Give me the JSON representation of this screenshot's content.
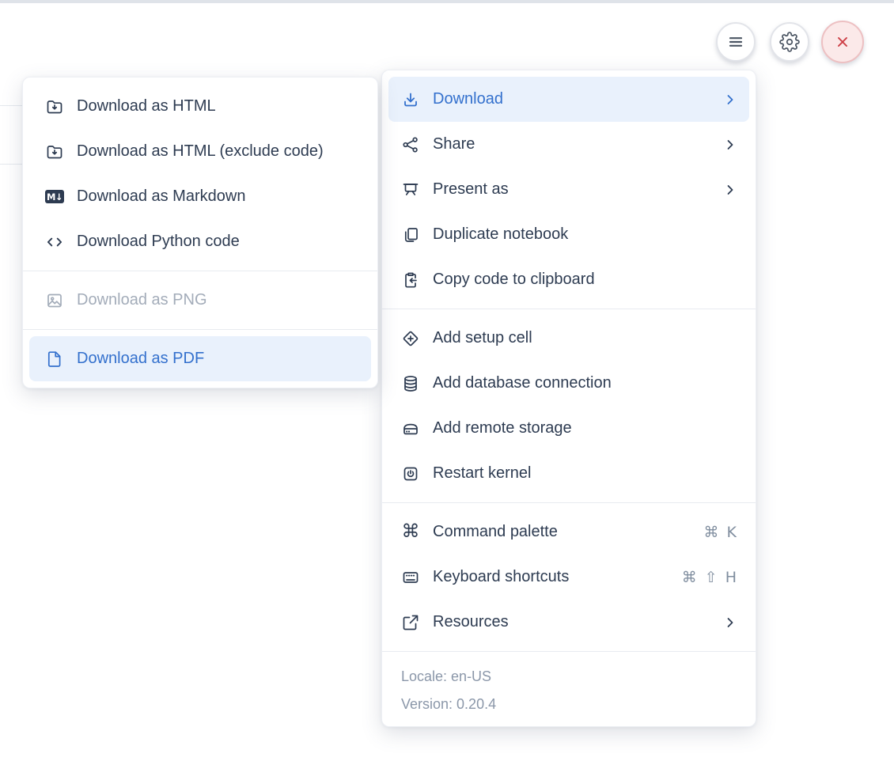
{
  "topbar": {
    "buttons": [
      {
        "name": "menu",
        "icon": "hamburger-icon"
      },
      {
        "name": "settings",
        "icon": "gear-icon"
      },
      {
        "name": "close",
        "icon": "close-icon"
      }
    ]
  },
  "menu": {
    "sections": [
      {
        "items": [
          {
            "label": "Download",
            "icon": "download-icon",
            "has_submenu": true,
            "active": true
          },
          {
            "label": "Share",
            "icon": "share-icon",
            "has_submenu": true
          },
          {
            "label": "Present as",
            "icon": "present-icon",
            "has_submenu": true
          },
          {
            "label": "Duplicate notebook",
            "icon": "duplicate-icon"
          },
          {
            "label": "Copy code to clipboard",
            "icon": "copy-clipboard-icon"
          }
        ]
      },
      {
        "items": [
          {
            "label": "Add setup cell",
            "icon": "add-setup-cell-icon"
          },
          {
            "label": "Add database connection",
            "icon": "database-icon"
          },
          {
            "label": "Add remote storage",
            "icon": "remote-storage-icon"
          },
          {
            "label": "Restart kernel",
            "icon": "restart-kernel-icon"
          }
        ]
      },
      {
        "items": [
          {
            "label": "Command palette",
            "icon": "command-icon",
            "shortcut": [
              "⌘",
              "K"
            ]
          },
          {
            "label": "Keyboard shortcuts",
            "icon": "keyboard-icon",
            "shortcut": [
              "⌘",
              "⇧",
              "H"
            ]
          },
          {
            "label": "Resources",
            "icon": "external-link-icon",
            "has_submenu": true
          }
        ]
      }
    ],
    "footer": {
      "locale": "Locale: en-US",
      "version": "Version: 0.20.4"
    },
    "command_glyph": "⌘"
  },
  "submenu": {
    "markdown_badge": "M↓",
    "sections": [
      {
        "items": [
          {
            "label": "Download as HTML",
            "icon": "folder-download-icon"
          },
          {
            "label": "Download as HTML (exclude code)",
            "icon": "folder-download-icon"
          },
          {
            "label": "Download as Markdown",
            "icon": "markdown-icon"
          },
          {
            "label": "Download Python code",
            "icon": "code-icon"
          }
        ]
      },
      {
        "items": [
          {
            "label": "Download as PNG",
            "icon": "image-icon",
            "disabled": true
          }
        ]
      },
      {
        "items": [
          {
            "label": "Download as PDF",
            "icon": "file-icon",
            "active": true
          }
        ]
      }
    ]
  },
  "colors": {
    "accent_blue": "#3370cd",
    "active_bg": "#e9f1fc",
    "text": "#2d3b51",
    "muted": "#8b97a9",
    "danger": "#cd3e45",
    "danger_bg": "#fbe9e9"
  }
}
